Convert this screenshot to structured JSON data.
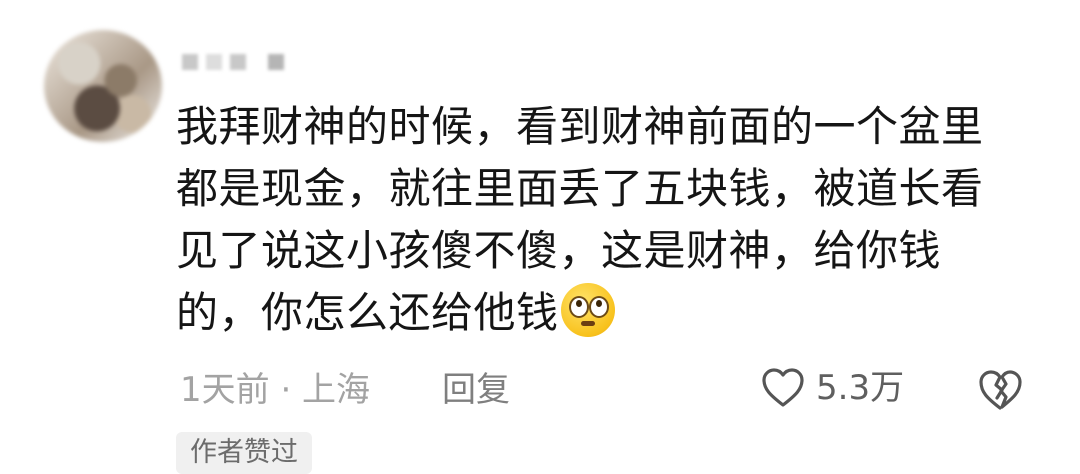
{
  "comment": {
    "lines": [
      "我拜财神的时候，看到财神前面的一个盆里",
      "都是现金，就往里面丢了五块钱，被道长看",
      "见了说这小孩傻不傻，这是财神，给你钱",
      "的，你怎么还给他钱"
    ],
    "emoji": "flushed-face-emoji"
  },
  "meta": {
    "time_location": "1天前 · 上海",
    "reply_label": "回复",
    "like_count": "5.3万",
    "like_icon": "heart-outline-icon",
    "dislike_icon": "broken-heart-icon",
    "author_liked_badge": "作者赞过"
  },
  "colors": {
    "text": "#151515",
    "meta": "#a3a3a3",
    "badge_bg": "#f0f0f0"
  }
}
